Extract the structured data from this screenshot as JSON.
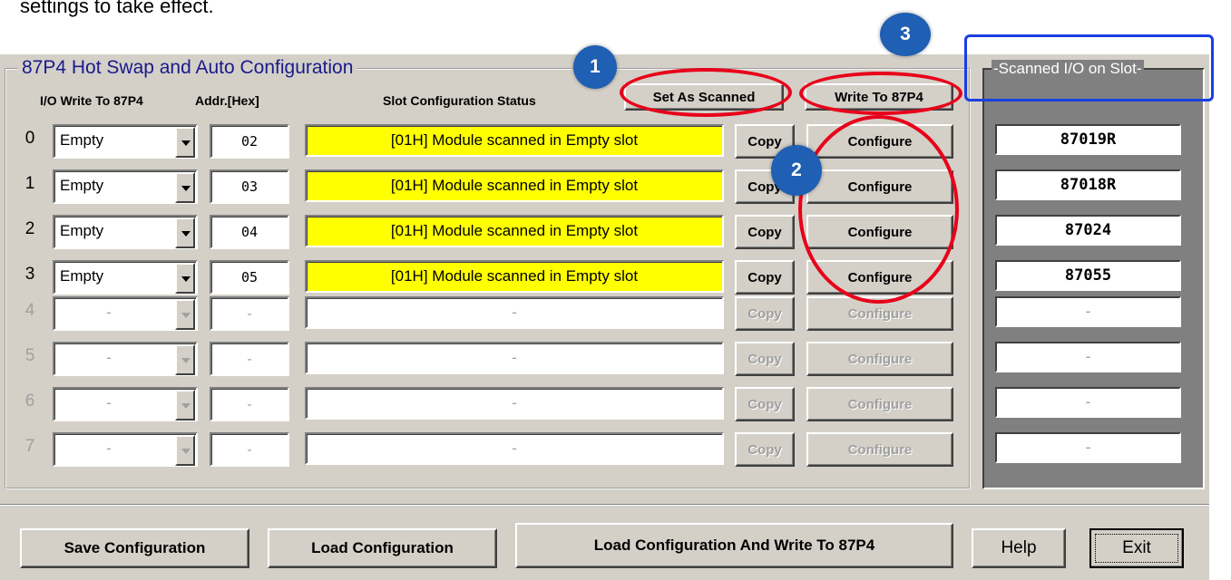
{
  "doc_text": "settings to take effect.",
  "app": {
    "frame_title": "87P4 Hot Swap and Auto Configuration",
    "header": {
      "io_write": "I/O Write To 87P4",
      "addr": "Addr.[Hex]",
      "slot_status": "Slot Configuration Status"
    },
    "top_buttons": {
      "set_as_scanned": "Set As Scanned",
      "write_to_87p4": "Write To 87P4"
    },
    "copy_label": "Copy",
    "configure_label": "Configure",
    "slots": [
      {
        "num": "0",
        "module": "Empty",
        "addr": "02",
        "status": "[01H] Module scanned in Empty slot",
        "scanned": "87019R"
      },
      {
        "num": "1",
        "module": "Empty",
        "addr": "03",
        "status": "[01H] Module scanned in Empty slot",
        "scanned": "87018R"
      },
      {
        "num": "2",
        "module": "Empty",
        "addr": "04",
        "status": "[01H] Module scanned in Empty slot",
        "scanned": "87024"
      },
      {
        "num": "3",
        "module": "Empty",
        "addr": "05",
        "status": "[01H] Module scanned in Empty slot",
        "scanned": "87055"
      },
      {
        "num": "4",
        "module": "-",
        "addr": "-",
        "status": "-",
        "scanned": "-"
      },
      {
        "num": "5",
        "module": "-",
        "addr": "-",
        "status": "-",
        "scanned": "-"
      },
      {
        "num": "6",
        "module": "-",
        "addr": "-",
        "status": "-",
        "scanned": "-"
      },
      {
        "num": "7",
        "module": "-",
        "addr": "-",
        "status": "-",
        "scanned": "-"
      }
    ],
    "scanned_panel_title": "Scanned I/O on Slot",
    "bottom_buttons": {
      "save": "Save Configuration",
      "load": "Load Configuration",
      "load_write": "Load  Configuration And Write To 87P4",
      "help": "Help",
      "exit": "Exit"
    }
  },
  "callouts": [
    "1",
    "2",
    "3"
  ],
  "colors": {
    "status_highlight": "#ffff00",
    "callout_fill": "#1f5fb4",
    "ring_red": "#e8001a",
    "box_blue": "#1a3fe0",
    "window_bg": "#d4d0c8"
  }
}
